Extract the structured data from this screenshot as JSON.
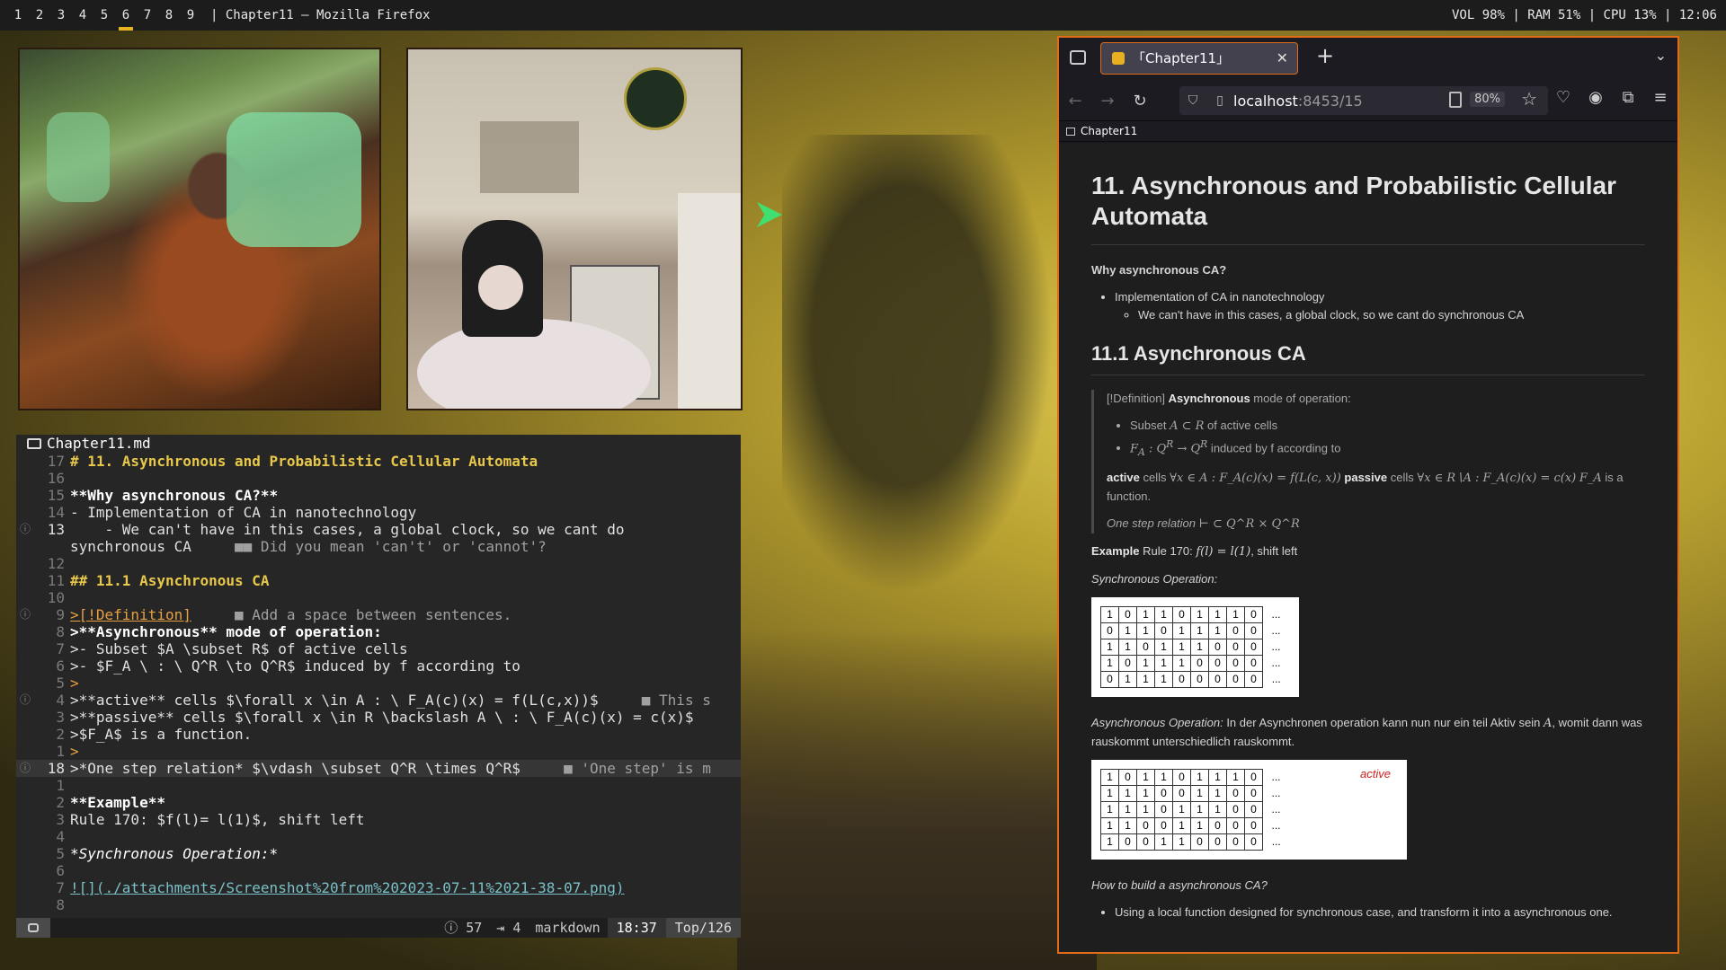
{
  "topbar": {
    "workspaces": [
      "1",
      "2",
      "3",
      "4",
      "5",
      "6",
      "7",
      "8",
      "9"
    ],
    "active_workspace": "6",
    "window_title": "| Chapter11 — Mozilla Firefox",
    "status": "VOL 98% | RAM 51% | CPU 13% | 12:06"
  },
  "editor": {
    "filename": "Chapter11.md",
    "lines": [
      {
        "num": "17",
        "text": "# 11. Asynchronous and Probabilistic Cellular Automata",
        "style": "h1"
      },
      {
        "num": "16",
        "text": ""
      },
      {
        "num": "15",
        "text": "**Why asynchronous CA?**",
        "style": "bold"
      },
      {
        "num": "14",
        "text": "- Implementation of CA in nanotechnology"
      },
      {
        "num": "13",
        "text": "    - We can't have in this cases, a global clock, so we cant do",
        "sign": "ⓘ",
        "cur": true
      },
      {
        "num": "",
        "text": "synchronous CA     ",
        "virt": "■■ Did you mean 'can't' or 'cannot'?"
      },
      {
        "num": "12",
        "text": ""
      },
      {
        "num": "11",
        "text": "## 11.1 Asynchronous CA",
        "style": "h2"
      },
      {
        "num": "10",
        "text": ""
      },
      {
        "num": "9",
        "text": ">[!Definition]",
        "style": "orange-ul",
        "sign": "ⓘ",
        "virt": "     ■ Add a space between sentences."
      },
      {
        "num": "8",
        "text": ">**Asynchronous** mode of operation:",
        "style": "bold"
      },
      {
        "num": "7",
        "text": ">- Subset $A \\subset R$ of active cells"
      },
      {
        "num": "6",
        "text": ">- $F_A \\ : \\ Q^R \\to Q^R$ induced by f according to"
      },
      {
        "num": "5",
        "text": ">",
        "style": "orange"
      },
      {
        "num": "4",
        "text": ">**active** cells $\\forall x \\in A : \\ F_A(c)(x) = f(L(c,x))$",
        "sign": "ⓘ",
        "virt": "     ■ This s"
      },
      {
        "num": "3",
        "text": ">**passive** cells $\\forall x \\in R \\backslash A \\ : \\ F_A(c)(x) = c(x)$"
      },
      {
        "num": "2",
        "text": ">$F_A$ is a function."
      },
      {
        "num": "1",
        "text": ">",
        "style": "orange"
      },
      {
        "num": "18",
        "text": ">*One step relation* $\\vdash \\subset Q^R \\times Q^R$",
        "sign": "ⓘ",
        "cur": true,
        "curline": true,
        "virt": "     ■ 'One step' is m"
      },
      {
        "num": "1",
        "text": ""
      },
      {
        "num": "2",
        "text": "**Example**",
        "style": "bold"
      },
      {
        "num": "3",
        "text": "Rule 170: $f(l)= l(1)$, shift left"
      },
      {
        "num": "4",
        "text": ""
      },
      {
        "num": "5",
        "text": "*Synchronous Operation:*",
        "style": "ital"
      },
      {
        "num": "6",
        "text": ""
      },
      {
        "num": "7",
        "text": "![](./attachments/Screenshot%20from%202023-07-11%2021-38-07.png)",
        "style": "link"
      },
      {
        "num": "8",
        "text": ""
      }
    ],
    "status": {
      "diagnostics": "ⓘ 57",
      "indent": "⇥ 4",
      "filetype": "markdown",
      "position": "18:37",
      "percent": "Top/126"
    }
  },
  "firefox": {
    "tab_title": "「Chapter11」",
    "url_host": "localhost",
    "url_path": ":8453/15",
    "zoom": "80%",
    "bookmark": "Chapter11",
    "content": {
      "h1": "11. Asynchronous and Probabilistic Cellular Automata",
      "why_heading": "Why asynchronous CA?",
      "bullet1": "Implementation of CA in nanotechnology",
      "bullet1_sub": "We can't have in this cases, a global clock, so we cant do synchronous CA",
      "h2": "11.1 Asynchronous CA",
      "def_tag": "[!Definition]",
      "def_bold": "Asynchronous",
      "def_rest": " mode of operation:",
      "subset_pre": "Subset ",
      "subset_math": "A ⊂ R",
      "subset_post": " of active cells",
      "fa_math": "F",
      "fa_sub": "A",
      "fa_math_rest": " : Q",
      "fa_R1": "R",
      "fa_arrow": " → Q",
      "fa_R2": "R",
      "fa_post": " induced by f according to",
      "active_bold": "active",
      "active_text": " cells ",
      "active_math": "∀x ∈ A :  F_A(c)(x) = f(L(c, x))",
      "passive_bold": "passive",
      "passive_text": " cells ",
      "passive_math": "∀x ∈ R∖A :  F_A(c)(x) = c(x)",
      "fa_func": "F_A",
      "fa_func_text": " is a function.",
      "onestep_ital": "One step relation",
      "onestep_math": "⊢ ⊂ Q^R × Q^R",
      "example_bold": "Example",
      "example_text": " Rule 170: ",
      "example_math": "f(l) = l(1)",
      "example_post": ", shift left",
      "sync_op": "Synchronous Operation:",
      "sync_table": [
        [
          "1",
          "0",
          "1",
          "1",
          "0",
          "1",
          "1",
          "1",
          "0"
        ],
        [
          "0",
          "1",
          "1",
          "0",
          "1",
          "1",
          "1",
          "0",
          "0"
        ],
        [
          "1",
          "1",
          "0",
          "1",
          "1",
          "1",
          "0",
          "0",
          "0"
        ],
        [
          "1",
          "0",
          "1",
          "1",
          "1",
          "0",
          "0",
          "0",
          "0"
        ],
        [
          "0",
          "1",
          "1",
          "1",
          "0",
          "0",
          "0",
          "0",
          "0"
        ]
      ],
      "dots": "...",
      "async_ital": "Asynchronous Operation:",
      "async_text_a": " In der Asynchronen operation kann nun nur ein teil Aktiv sein ",
      "async_math": "A",
      "async_text_b": ", womit dann was rauskommt unterschiedlich rauskommt.",
      "async_table": [
        [
          "1",
          "0",
          "1",
          "1",
          "0",
          "1",
          "1",
          "1",
          "0"
        ],
        [
          "1",
          "1",
          "1",
          "0",
          "0",
          "1",
          "1",
          "0",
          "0"
        ],
        [
          "1",
          "1",
          "1",
          "0",
          "1",
          "1",
          "1",
          "0",
          "0"
        ],
        [
          "1",
          "1",
          "0",
          "0",
          "1",
          "1",
          "0",
          "0",
          "0"
        ],
        [
          "1",
          "0",
          "0",
          "1",
          "1",
          "0",
          "0",
          "0",
          "0"
        ]
      ],
      "active_label": "active",
      "how_build": "How to build a asynchronous CA?",
      "how_bullet": "Using a local function designed for synchronous case, and transform it into a asynchronous one."
    }
  },
  "colors": {
    "accent": "#e06c1a",
    "heading": "#e8c84a",
    "workspace_indicator": "#e6b422"
  }
}
